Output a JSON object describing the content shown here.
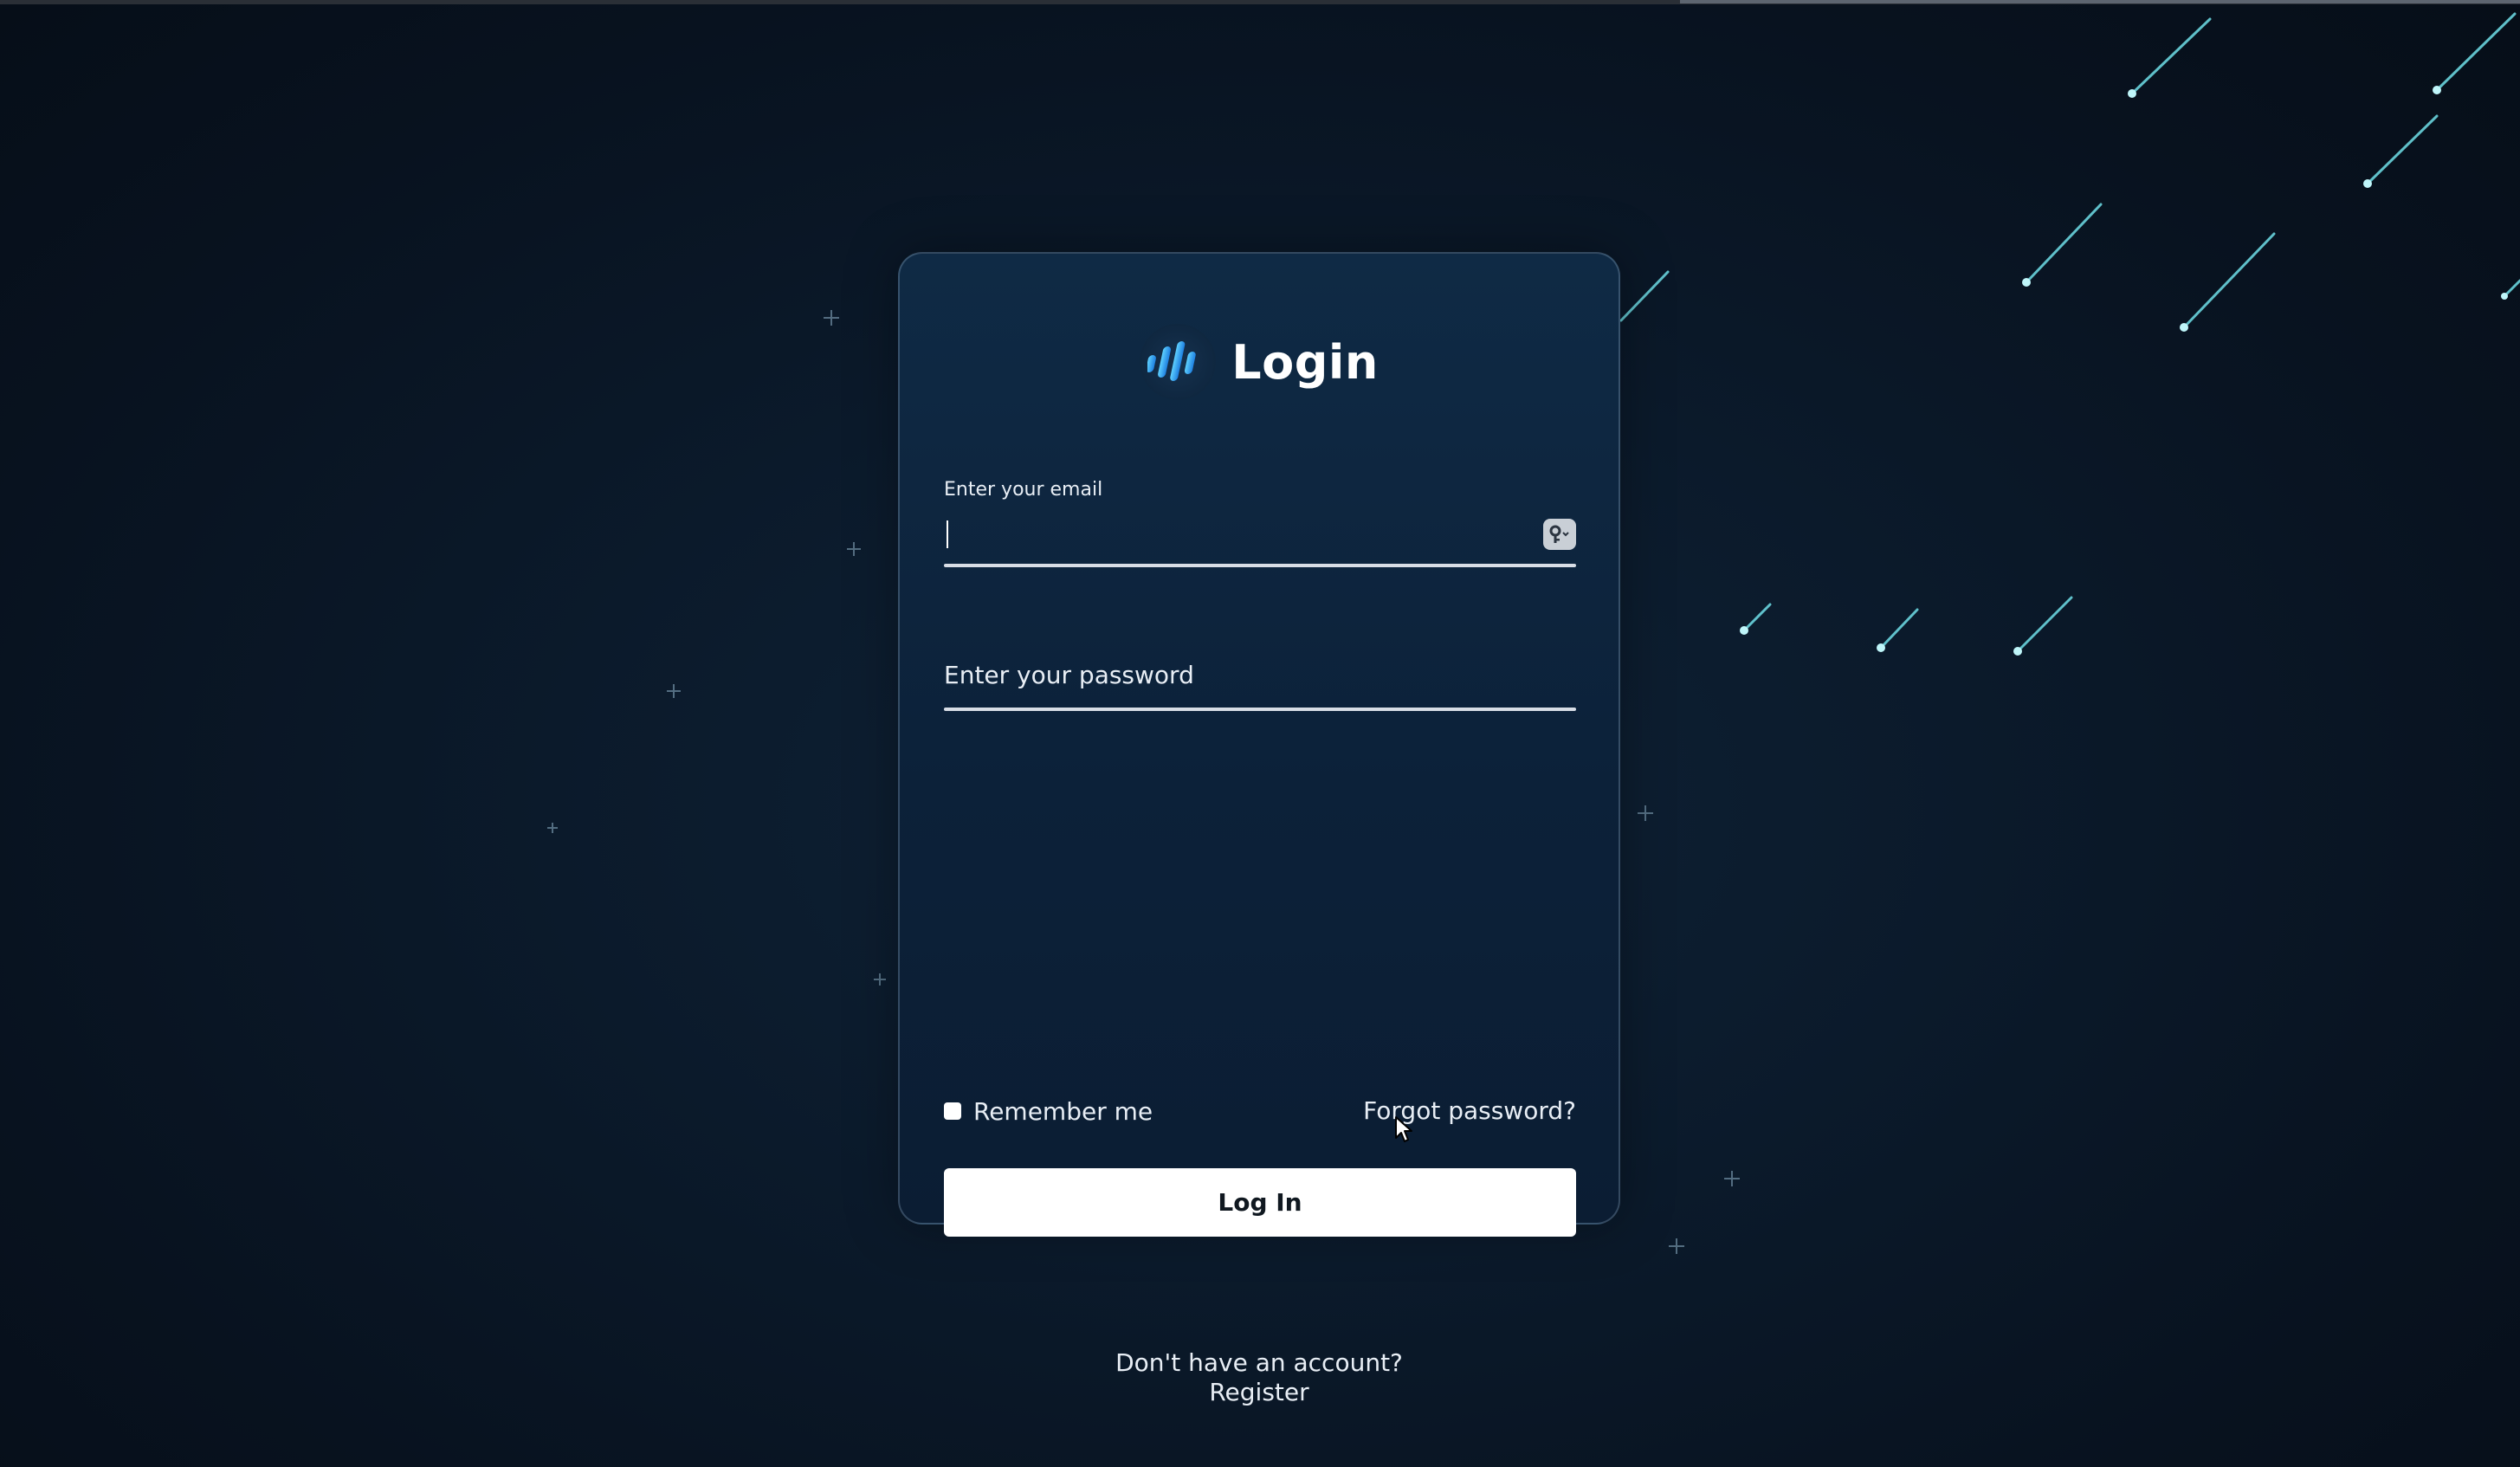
{
  "login": {
    "title": "Login",
    "logo_icon": "sound-wave-logo-icon",
    "email": {
      "label": "Enter your email",
      "value": "",
      "key_icon": "password-manager-key-icon"
    },
    "password": {
      "placeholder": "Enter your password",
      "value": ""
    },
    "remember_label": "Remember me",
    "remember_checked": false,
    "forgot_label": "Forgot password?",
    "login_button_label": "Log In",
    "register_prompt": "Don't have an account?",
    "register_label": "Register"
  },
  "colors": {
    "background": "#0b1a2b",
    "card": "#0f2a45",
    "accent_blue": "#2fa8ff",
    "shooting_star": "#7fe8f0",
    "button": "#ffffff"
  }
}
